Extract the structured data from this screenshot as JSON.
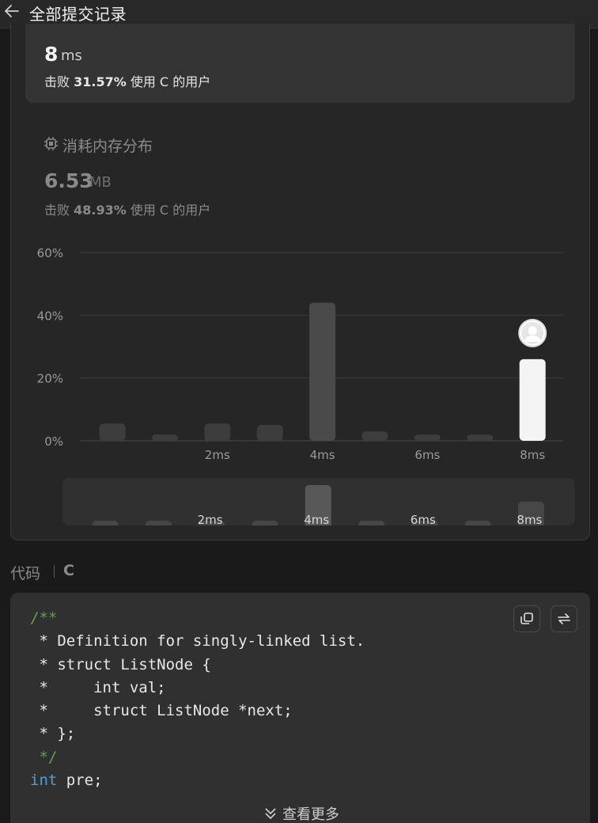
{
  "header": {
    "title": "全部提交记录",
    "back_icon": "arrow-left-icon"
  },
  "runtime": {
    "value": "8",
    "unit": "ms",
    "beat_prefix": "击败",
    "beat_percent": "31.57%",
    "beat_suffix": "使用 C 的用户"
  },
  "memory": {
    "title": "消耗内存分布",
    "icon": "chip-icon",
    "value": "6.53",
    "unit": "MB",
    "beat_prefix": "击败",
    "beat_percent": "48.93%",
    "beat_suffix": "使用 C 的用户"
  },
  "chart_data": {
    "type": "bar",
    "y_ticks": [
      "60%",
      "40%",
      "20%",
      "0%"
    ],
    "ylim": [
      0,
      60
    ],
    "categories": [
      "",
      "",
      "2ms",
      "",
      "4ms",
      "",
      "6ms",
      "",
      "8ms"
    ],
    "values": [
      5.5,
      2,
      5.5,
      5,
      44,
      3,
      2,
      2,
      26
    ],
    "highlight_index": 8,
    "bar_color": "#3d3d3d",
    "highlight_color": "#f4f4f4",
    "grid": true,
    "marker": "avatar-icon"
  },
  "mini_chart": {
    "labels": [
      "",
      "",
      "2ms",
      "",
      "4ms",
      "",
      "6ms",
      "",
      "8ms"
    ],
    "values": [
      3,
      3,
      3,
      3,
      44,
      3,
      3,
      3,
      26
    ]
  },
  "code": {
    "label": "代码",
    "language": "C",
    "lines": [
      [
        {
          "t": "/**",
          "c": "comment"
        }
      ],
      [
        {
          "t": " * Definition for singly-linked list.",
          "c": "text"
        }
      ],
      [
        {
          "t": " * struct ListNode {",
          "c": "text"
        }
      ],
      [
        {
          "t": " *     int val;",
          "c": "text"
        }
      ],
      [
        {
          "t": " *     struct ListNode *next;",
          "c": "text"
        }
      ],
      [
        {
          "t": " * };",
          "c": "text"
        }
      ],
      [
        {
          "t": " */",
          "c": "comment"
        }
      ],
      [
        {
          "t": "int",
          "c": "kw"
        },
        {
          "t": " pre;",
          "c": "text"
        }
      ]
    ],
    "copy_icon": "copy-icon",
    "swap_icon": "swap-icon",
    "more_label": "查看更多",
    "more_icon": "double-chevron-down-icon"
  }
}
